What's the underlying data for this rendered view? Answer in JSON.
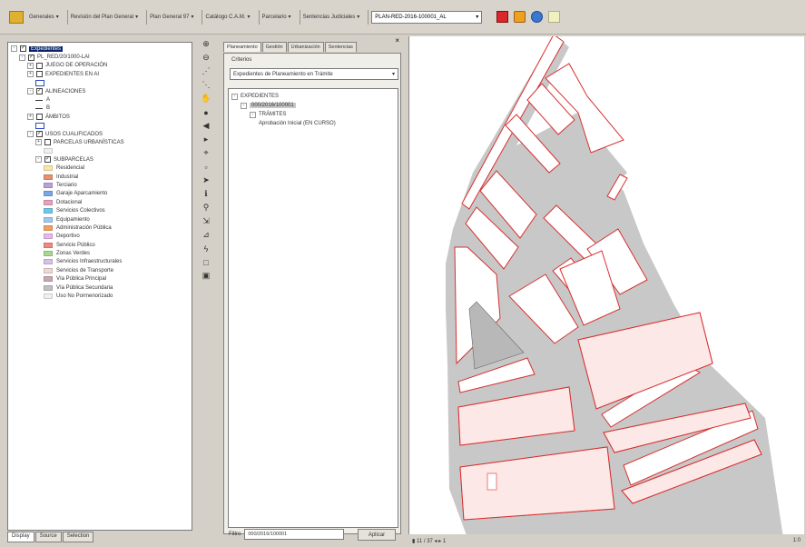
{
  "toolbar": {
    "menus": [
      "Generales",
      "Revisión del Plan General",
      "Plan General 97",
      "Catálogo C.A.M.",
      "Parcelario",
      "Sentencias Judiciales"
    ],
    "combo_value": "PLAN-RED-2016-100001_AL",
    "icons": [
      "app-logo-icon",
      "red-stop-icon",
      "help-icon",
      "globe-icon",
      "settings-icon"
    ]
  },
  "legend": {
    "tree": [
      {
        "level": 0,
        "exp": "-",
        "checked": true,
        "label": "Expedientes",
        "selected": true
      },
      {
        "level": 1,
        "exp": "-",
        "checked": true,
        "label": "PL_RED/20/1000-LAI"
      },
      {
        "level": 2,
        "exp": "+",
        "checked": false,
        "label": "JUEGO DE OPERACIÓN"
      },
      {
        "level": 2,
        "exp": "+",
        "checked": false,
        "label": "EXPEDIENTES EN AI"
      },
      {
        "level": 3,
        "symbol": "box"
      },
      {
        "level": 2,
        "exp": "-",
        "checked": true,
        "label": "ALINEACIONES"
      },
      {
        "level": 3,
        "symbol": "line",
        "label": "A"
      },
      {
        "level": 3,
        "symbol": "line",
        "label": "B"
      },
      {
        "level": 2,
        "exp": "+",
        "checked": false,
        "label": "ÁMBITOS"
      },
      {
        "level": 3,
        "symbol": "box"
      },
      {
        "level": 2,
        "exp": "-",
        "checked": true,
        "label": "USOS CUALIFICADOS"
      },
      {
        "level": 3,
        "exp": "+",
        "checked": false,
        "label": "PARCELAS URBANÍSTICAS"
      },
      {
        "level": 4,
        "symbol": "swatch",
        "color": "#f0f0f0"
      },
      {
        "level": 3,
        "exp": "-",
        "checked": true,
        "label": "SUBPARCELAS"
      },
      {
        "level": 4,
        "symbol": "swatch",
        "color": "#fbe6a8",
        "label": "Residencial"
      },
      {
        "level": 4,
        "symbol": "swatch",
        "color": "#e89070",
        "label": "Industrial"
      },
      {
        "level": 4,
        "symbol": "swatch",
        "color": "#b8a0e0",
        "label": "Terciario"
      },
      {
        "level": 4,
        "symbol": "swatch",
        "color": "#78a8e8",
        "label": "Garaje Aparcamiento"
      },
      {
        "level": 4,
        "symbol": "swatch",
        "color": "#e8a0c0",
        "label": "Dotacional"
      },
      {
        "level": 4,
        "symbol": "swatch",
        "color": "#70c8e8",
        "label": "Servicios Colectivos"
      },
      {
        "level": 4,
        "symbol": "swatch",
        "color": "#a0c8f0",
        "label": "Equipamiento"
      },
      {
        "level": 4,
        "symbol": "swatch",
        "color": "#f0a060",
        "label": "Administración Pública"
      },
      {
        "level": 4,
        "symbol": "swatch",
        "color": "#e8b8e8",
        "label": "Deportivo"
      },
      {
        "level": 4,
        "symbol": "swatch",
        "color": "#f08880",
        "label": "Servicio Público"
      },
      {
        "level": 4,
        "symbol": "swatch",
        "color": "#a8d890",
        "label": "Zonas Verdes"
      },
      {
        "level": 4,
        "symbol": "swatch",
        "color": "#d8c0e8",
        "label": "Servicios Infraestructurales"
      },
      {
        "level": 4,
        "symbol": "swatch",
        "color": "#f0d8d8",
        "label": "Servicios de Transporte"
      },
      {
        "level": 4,
        "symbol": "swatch",
        "color": "#c8a8b0",
        "label": "Vía Pública Principal"
      },
      {
        "level": 4,
        "symbol": "swatch",
        "color": "#c0c0c8",
        "label": "Vía Pública Secundaria"
      },
      {
        "level": 4,
        "symbol": "swatch",
        "color": "#f0f0f0",
        "label": "Uso No Pormenorizado"
      }
    ],
    "tabs": [
      "Display",
      "Source",
      "Selection"
    ]
  },
  "vtools": [
    {
      "name": "zoom-in-icon",
      "glyph": "⊕"
    },
    {
      "name": "zoom-out-icon",
      "glyph": "⊖"
    },
    {
      "name": "fixed-zoom-in-icon",
      "glyph": "⋰"
    },
    {
      "name": "fixed-zoom-out-icon",
      "glyph": "⋱"
    },
    {
      "name": "pan-icon",
      "glyph": "✋"
    },
    {
      "name": "full-extent-icon",
      "glyph": "●"
    },
    {
      "name": "back-extent-icon",
      "glyph": "◀"
    },
    {
      "name": "forward-extent-icon",
      "glyph": "▸"
    },
    {
      "name": "select-features-icon",
      "glyph": "⌖"
    },
    {
      "name": "clear-selection-icon",
      "glyph": "▫"
    },
    {
      "name": "select-elements-icon",
      "glyph": "➤"
    },
    {
      "name": "identify-icon",
      "glyph": "ℹ"
    },
    {
      "name": "find-icon",
      "glyph": "⚲"
    },
    {
      "name": "go-to-xy-icon",
      "glyph": "⇲"
    },
    {
      "name": "measure-icon",
      "glyph": "⊿"
    },
    {
      "name": "hyperlink-icon",
      "glyph": "ϟ"
    },
    {
      "name": "html-popup-icon",
      "glyph": "□"
    },
    {
      "name": "layout-icon",
      "glyph": "▣"
    }
  ],
  "explorer": {
    "tabs": [
      "Planeamiento",
      "Gestión",
      "Urbanización",
      "Sentencias"
    ],
    "criteria_label": "Criterios",
    "criteria_value": "Expedientes de Planeamiento en Trámite",
    "tree": [
      {
        "level": 0,
        "exp": "-",
        "label": "EXPEDIENTES"
      },
      {
        "level": 1,
        "exp": "-",
        "label": "000/2016/100001",
        "highlight": true
      },
      {
        "level": 2,
        "exp": "-",
        "label": "TRÁMITES"
      },
      {
        "level": 3,
        "label": "Aprobación Inicial (EN CURSO)"
      }
    ],
    "filter_label": "Filtro",
    "filter_value": "000/2016/100001",
    "apply_label": "Aplicar"
  },
  "map": {
    "status_left": "▮ 11 / 37 ◂ ▸ 1",
    "status_right": "1:0",
    "street_color": "#c8c8c8",
    "outline_color": "#d83030",
    "parcel_fill": "#fde8e8",
    "park_fill": "#b8b8b8"
  }
}
